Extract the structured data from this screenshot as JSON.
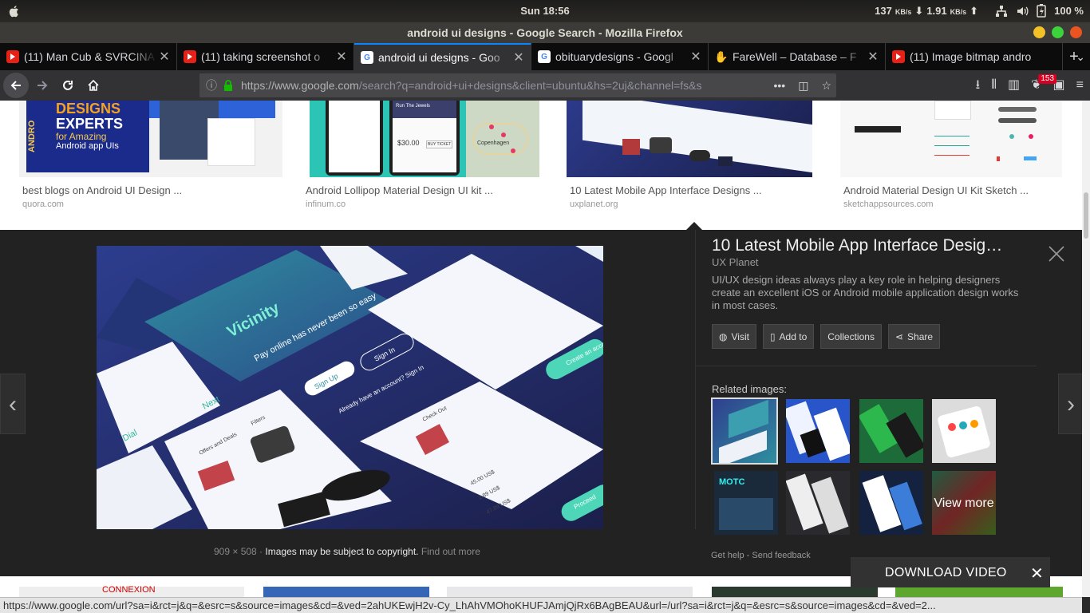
{
  "os_panel": {
    "clock": "Sun 18:56",
    "download_speed": "137",
    "download_unit": "KB/s",
    "upload_speed": "1.91",
    "upload_unit": "KB/s",
    "battery": "100 %"
  },
  "window": {
    "title": "android ui designs - Google Search - Mozilla Firefox"
  },
  "tabs": [
    {
      "label": "(11) Man Cub & SVRCINA",
      "favicon": "youtube-icon",
      "active": false
    },
    {
      "label": "(11) taking screenshot o",
      "favicon": "youtube-icon",
      "active": false
    },
    {
      "label": "android ui designs - Goo",
      "favicon": "google-icon",
      "active": true
    },
    {
      "label": "obituarydesigns - Googl",
      "favicon": "google-icon",
      "active": false
    },
    {
      "label": "FareWell – Database – F",
      "favicon": "hand-icon",
      "active": false
    },
    {
      "label": "(11) Image bitmap andro",
      "favicon": "youtube-icon",
      "active": false
    }
  ],
  "navbar": {
    "url_main": "https://www.google.com",
    "url_rest": "/search?q=android+ui+designs&client=ubuntu&hs=2uj&channel=fs&s",
    "notification_count": "153"
  },
  "results": [
    {
      "title": "best blogs on Android UI Design ...",
      "domain": "quora.com",
      "thumb_lines": [
        "DESIGNS",
        "EXPERTS",
        "for Amazing",
        "Android app UIs"
      ],
      "side_text": "ANDRO"
    },
    {
      "title": "Android Lollipop Material Design UI kit ...",
      "domain": "infinum.co",
      "thumb_lines": [
        "Run The Jewels",
        "$30.00",
        "BUY TICKET",
        "Copenhagen"
      ]
    },
    {
      "title": "10 Latest Mobile App Interface Designs ...",
      "domain": "uxplanet.org"
    },
    {
      "title": "Android Material Design UI Kit Sketch ...",
      "domain": "sketchappsources.com"
    }
  ],
  "detail": {
    "title": "10 Latest Mobile App Interface Desig…",
    "source": "UX Planet",
    "description": "UI/UX design ideas always play a key role in helping designers create an excellent iOS or Android mobile application design works in most cases.",
    "buttons": {
      "visit": "Visit",
      "add_to": "Add to",
      "collections": "Collections",
      "share": "Share"
    },
    "related_label": "Related images:",
    "view_more": "View more",
    "dimensions": "909 × 508",
    "copyright": "Images may be subject to copyright.",
    "find_out_more": "Find out more",
    "get_help": "Get help",
    "separator": "-",
    "send_feedback": "Send feedback",
    "preview_texts": {
      "brand": "Vicinity",
      "tagline": "Pay online has never been so easy",
      "sign_up": "Sign Up",
      "sign_in": "Sign In",
      "already": "Already have an account? Sign In",
      "dial": "Dial",
      "next": "Next",
      "offers": "Offers and Deals",
      "filters": "Filters",
      "check_out": "Check Out",
      "price": "45.00 US$",
      "tax": "2.89 US$",
      "total": "47.89 US$",
      "proceed": "Proceed",
      "create_account": "Create an acco"
    }
  },
  "download_bar": {
    "label": "DOWNLOAD VIDEO"
  },
  "bottom_row": {
    "text": "CONNEXION"
  },
  "status_url": "https://www.google.com/url?sa=i&rct=j&q=&esrc=s&source=images&cd=&ved=2ahUKEwjH2v-Cy_LhAhVMOhoKHUFJAmjQjRx6BAgBEAU&url=/url?sa=i&rct=j&q=&esrc=s&source=images&cd=&ved=2..."
}
